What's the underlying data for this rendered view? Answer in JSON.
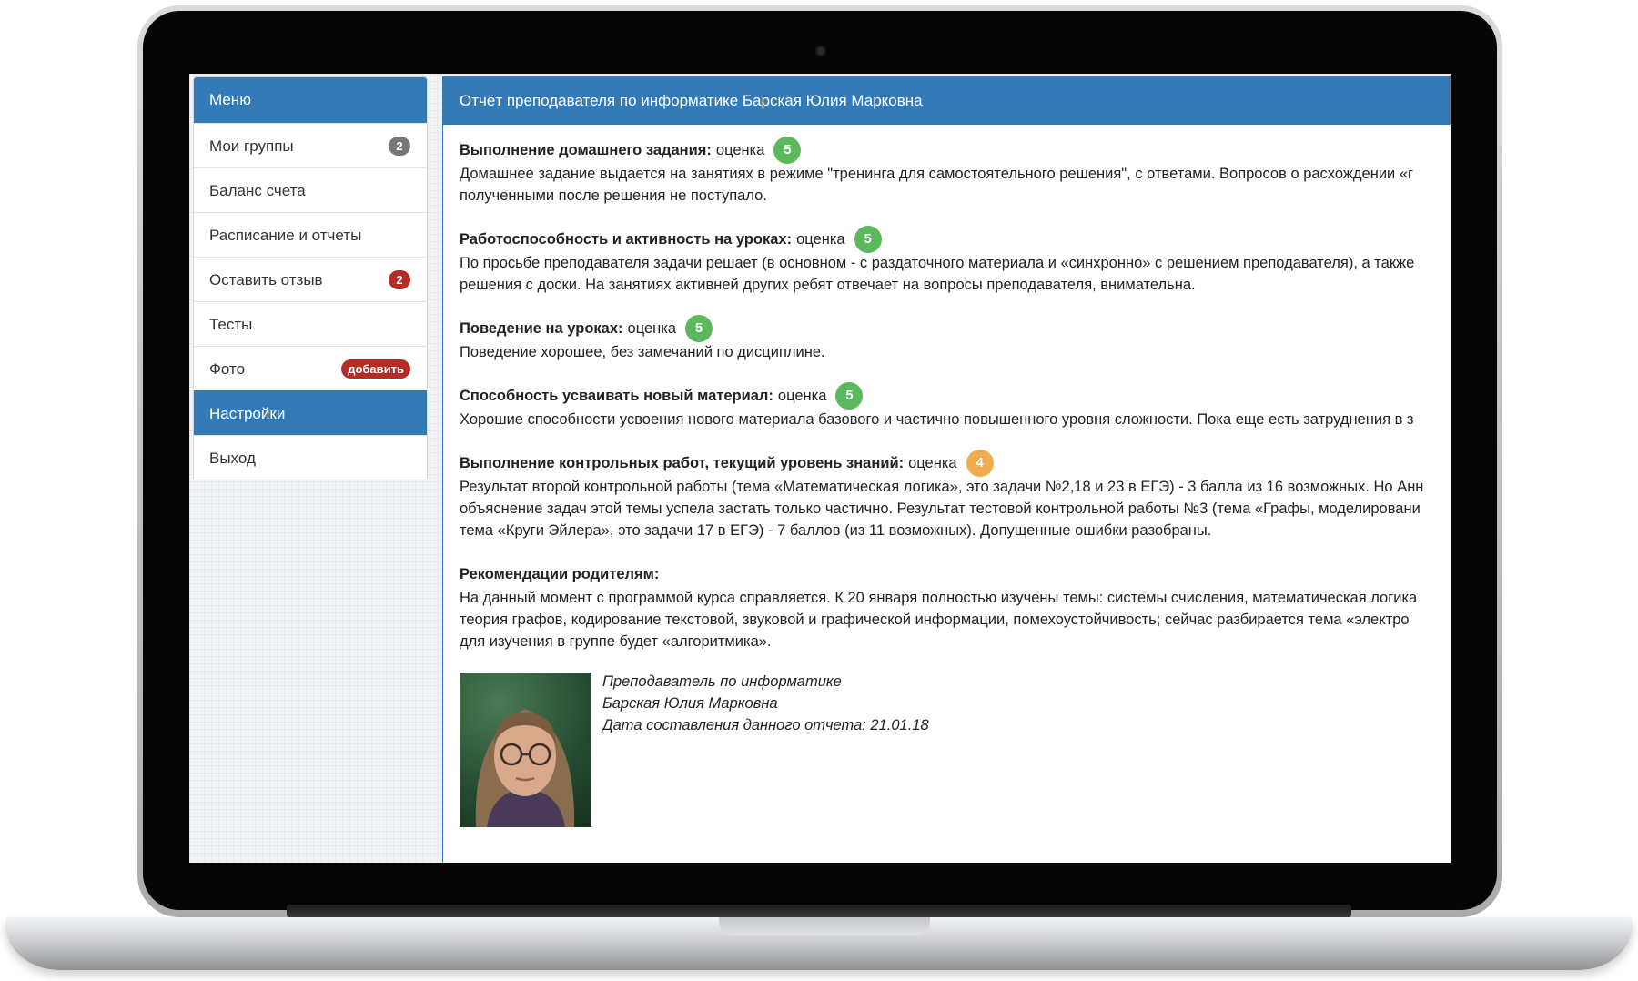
{
  "sidebar": {
    "header": "Меню",
    "items": [
      {
        "label": "Мои группы",
        "badge": "2"
      },
      {
        "label": "Баланс счета"
      },
      {
        "label": "Расписание и отчеты"
      },
      {
        "label": "Оставить отзыв",
        "badge": "2"
      },
      {
        "label": "Тесты"
      },
      {
        "label": "Фото",
        "badge": "добавить"
      },
      {
        "label": "Настройки",
        "active": true
      },
      {
        "label": "Выход"
      }
    ]
  },
  "report": {
    "title": "Отчёт преподавателя по информатике Барская Юлия Марковна",
    "grade_word": "оценка",
    "sections": [
      {
        "heading": "Выполнение домашнего задания:",
        "grade": "5",
        "lines": [
          "Домашнее задание выдается на занятиях в режиме \"тренинга для самостоятельного решения\", с ответами. Вопросов о расхождении «г",
          "полученными после решения не поступало."
        ]
      },
      {
        "heading": "Работоспособность и активность на уроках:",
        "grade": "5",
        "lines": [
          "По просьбе преподавателя задачи решает (в основном - с раздаточного материала и «синхронно» с решением преподавателя), а также",
          "решения с доски. На занятиях активней других ребят отвечает на вопросы преподавателя, внимательна."
        ]
      },
      {
        "heading": "Поведение на уроках:",
        "grade": "5",
        "lines": [
          "Поведение хорошее, без замечаний по дисциплине."
        ]
      },
      {
        "heading": "Способность усваивать новый материал:",
        "grade": "5",
        "lines": [
          "Хорошие способности усвоения нового материала базового и частично повышенного уровня сложности. Пока еще есть затруднения в з"
        ]
      },
      {
        "heading": "Выполнение контрольных работ, текущий уровень знаний:",
        "grade": "4",
        "lines": [
          "Результат второй контрольной работы (тема «Математическая логика», это задачи №2,18 и 23 в ЕГЭ) - 3 балла из 16 возможных. Но Анн",
          "объяснение задач этой темы успела застать только частично. Результат тестовой контрольной работы №3 (тема «Графы, моделировани",
          "тема «Круги Эйлера», это задачи 17 в ЕГЭ) - 7 баллов (из 11 возможных). Допущенные ошибки разобраны."
        ]
      },
      {
        "heading": "Рекомендации родителям:",
        "lines": [
          "На данный момент с программой курса справляется. К 20 января полностью изучены темы: системы счисления, математическая логика",
          "теория графов, кодирование текстовой, звуковой и графической информации, помехоустойчивость; сейчас разбирается тема «электро",
          "для изучения в группе будет «алгоритмика»."
        ]
      }
    ],
    "signature": {
      "role": "Преподаватель по информатике",
      "name": "Барская Юлия Марковна",
      "date": "Дата составления данного отчета: 21.01.18"
    }
  },
  "colors": {
    "primary": "#337ab7",
    "grade_green": "#5cb85c",
    "grade_orange": "#f0ad4e",
    "badge_gray": "#777777",
    "badge_red": "#b52b26"
  }
}
